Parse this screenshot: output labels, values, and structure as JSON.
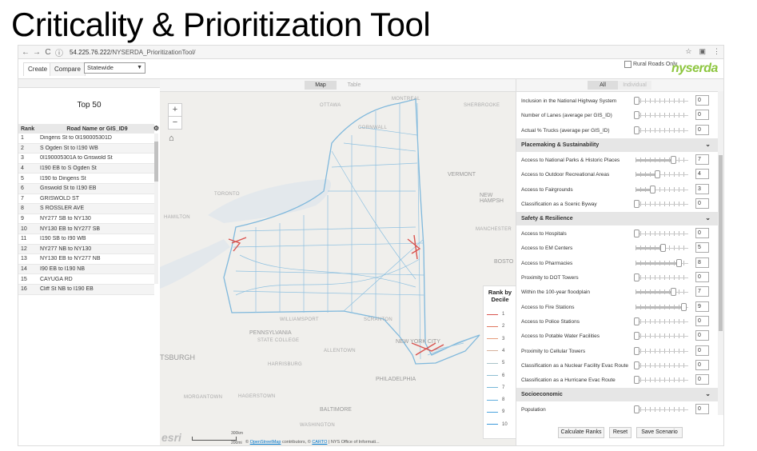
{
  "slide_title": "Criticality & Prioritization Tool",
  "browser": {
    "url_host": "54.225.76.222",
    "url_path": "/NYSERDA_PrioritizationTool/"
  },
  "header": {
    "tabs": [
      "Create",
      "Compare"
    ],
    "region_select": "Statewide",
    "rural_roads_label": "Rural Roads Only",
    "logo_text": "nyserda"
  },
  "left_panel": {
    "title": "Top 50",
    "columns": [
      "Rank",
      "Road Name or GIS_ID9"
    ],
    "rows": [
      [
        "1",
        "Dingens St to 0I190005301D"
      ],
      [
        "2",
        "S Ogden St to I190 WB"
      ],
      [
        "3",
        "0I190005301A to Griswold St"
      ],
      [
        "4",
        "I190 EB to S Ogden St"
      ],
      [
        "5",
        "I190 to Dingens St"
      ],
      [
        "6",
        "Griswold St to I190 EB"
      ],
      [
        "7",
        "GRISWOLD ST"
      ],
      [
        "8",
        "S ROSSLER AVE"
      ],
      [
        "9",
        "NY277 SB to NY130"
      ],
      [
        "10",
        "NY130 EB to NY277 SB"
      ],
      [
        "11",
        "I190 SB to I90 WB"
      ],
      [
        "12",
        "NY277 NB to NY130"
      ],
      [
        "13",
        "NY130 EB to NY277 NB"
      ],
      [
        "14",
        "I90 EB to I190 NB"
      ],
      [
        "15",
        "CAYUGA RD"
      ],
      [
        "16",
        "Cliff St NB to I190 EB"
      ]
    ]
  },
  "map": {
    "tabs": {
      "map": "Map",
      "table": "Table"
    },
    "zoom_in": "+",
    "zoom_out": "−",
    "labels": {
      "ottawa": "OTTAWA",
      "montreal": "MONTREAL",
      "sherbrooke": "SHERBROOKE",
      "cornwall": "CORNWALL",
      "toronto": "TORONTO",
      "hamilton": "HAMILTON",
      "vermont": "VERMONT",
      "new_hampshire": "NEW HAMPSH",
      "manchester": "MANCHESTER",
      "boston": "BOSTO",
      "pennsylvania": "PENNSYLVANIA",
      "state_college": "STATE COLLEGE",
      "williamsport": "WILLIAMSPORT",
      "scranton": "SCRANTON",
      "allentown": "ALLENTOWN",
      "new_york_city": "NEW YORK CITY",
      "philadelphia": "PHILADELPHIA",
      "pittsburgh": "TSBURGH",
      "harrisburg": "HARRISBURG",
      "morgantown": "MORGANTOWN",
      "hagerstown": "HAGERSTOWN",
      "baltimore": "BALTIMORE",
      "washington": "WASHINGTON"
    },
    "legend": {
      "title": "Rank by Decile",
      "items": [
        "1",
        "2",
        "3",
        "4",
        "5",
        "6",
        "7",
        "8",
        "9",
        "10"
      ],
      "colors": [
        "#d9534f",
        "#e07860",
        "#e69c7c",
        "#d6b19c",
        "#a9c3c9",
        "#8fbfd3",
        "#76b7d9",
        "#5faddd",
        "#4aa3de",
        "#3a98da"
      ]
    },
    "esri": "esri",
    "scale_km": "300km",
    "scale_mi": "200mi",
    "attribution_prefix": "©",
    "attribution_osm": "OpenStreetMap",
    "attribution_mid": " contributors, ©",
    "attribution_carto": "CARTO",
    "attribution_end": " | NYS Office of Informati..."
  },
  "right_panel": {
    "tabs": {
      "all": "All",
      "individual": "Individual"
    },
    "items": [
      {
        "type": "criterion",
        "label": "Inclusion in the National Highway System",
        "value": 0,
        "level": 0
      },
      {
        "type": "criterion",
        "label": "Number of Lanes (average per GIS_ID)",
        "value": 0,
        "level": 0
      },
      {
        "type": "criterion",
        "label": "Actual % Trucks (average per GIS_ID)",
        "value": 0,
        "level": 0
      },
      {
        "type": "section",
        "label": "Placemaking & Sustainability"
      },
      {
        "type": "criterion",
        "label": "Access to National Parks & Historic Places",
        "value": 7,
        "level": 0.7
      },
      {
        "type": "criterion",
        "label": "Access to Outdoor Recreational Areas",
        "value": 4,
        "level": 0.4
      },
      {
        "type": "criterion",
        "label": "Access to Fairgrounds",
        "value": 3,
        "level": 0.3
      },
      {
        "type": "criterion",
        "label": "Classification as a Scenic Byway",
        "value": 0,
        "level": 0
      },
      {
        "type": "section",
        "label": "Safety & Resilience"
      },
      {
        "type": "criterion",
        "label": "Access to Hospitals",
        "value": 0,
        "level": 0
      },
      {
        "type": "criterion",
        "label": "Access to EM Centers",
        "value": 5,
        "level": 0.5
      },
      {
        "type": "criterion",
        "label": "Access to Pharmacies",
        "value": 8,
        "level": 0.8
      },
      {
        "type": "criterion",
        "label": "Proximity to DOT Towers",
        "value": 0,
        "level": 0
      },
      {
        "type": "criterion",
        "label": "Within the 100-year floodplain",
        "value": 7,
        "level": 0.7
      },
      {
        "type": "criterion",
        "label": "Access to Fire Stations",
        "value": 9,
        "level": 0.9
      },
      {
        "type": "criterion",
        "label": "Access to Police Stations",
        "value": 0,
        "level": 0
      },
      {
        "type": "criterion",
        "label": "Access to Potable Water Facilities",
        "value": 0,
        "level": 0
      },
      {
        "type": "criterion",
        "label": "Proximity to Cellular Towers",
        "value": 0,
        "level": 0
      },
      {
        "type": "criterion",
        "label": "Classification as a Nuclear Facility Evac Route",
        "value": 0,
        "level": 0
      },
      {
        "type": "criterion",
        "label": "Classification as a Hurricane Evac Route",
        "value": 0,
        "level": 0
      },
      {
        "type": "section",
        "label": "Socioeconomic"
      },
      {
        "type": "criterion",
        "label": "Population",
        "value": 0,
        "level": 0
      }
    ],
    "buttons": {
      "calculate": "Calculate Ranks",
      "reset": "Reset",
      "save": "Save Scenario"
    }
  }
}
